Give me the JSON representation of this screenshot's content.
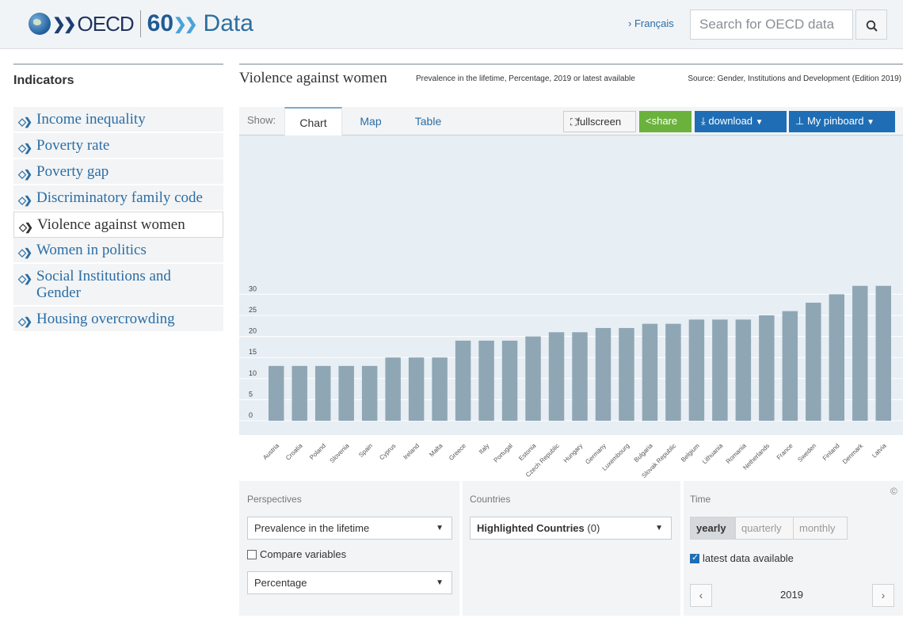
{
  "header": {
    "brand": "OECD",
    "anniversary": "60",
    "section": "Data",
    "language_link": "› Français",
    "search_placeholder": "Search for OECD data"
  },
  "sidebar": {
    "title": "Indicators",
    "items": [
      {
        "label": "Income inequality",
        "active": false
      },
      {
        "label": "Poverty rate",
        "active": false
      },
      {
        "label": "Poverty gap",
        "active": false
      },
      {
        "label": "Discriminatory family code",
        "active": false
      },
      {
        "label": "Violence against women",
        "active": true
      },
      {
        "label": "Women in politics",
        "active": false
      },
      {
        "label": "Social Institutions and Gender",
        "active": false
      },
      {
        "label": "Housing overcrowding",
        "active": false
      }
    ]
  },
  "main": {
    "title": "Violence against women",
    "subtitle": "Prevalence in the lifetime, Percentage, 2019 or latest available",
    "source": "Source: Gender, Institutions and Development (Edition 2019)"
  },
  "toolbar": {
    "show_label": "Show:",
    "tabs": [
      "Chart",
      "Map",
      "Table"
    ],
    "active_tab": "Chart",
    "fullscreen": "fullscreen",
    "share": "share",
    "download": "download",
    "pinboard": "My pinboard"
  },
  "chart_data": {
    "type": "bar",
    "categories": [
      "Austria",
      "Croatia",
      "Poland",
      "Slovenia",
      "Spain",
      "Cyprus",
      "Ireland",
      "Malta",
      "Greece",
      "Italy",
      "Portugal",
      "Estonia",
      "Czech Republic",
      "Hungary",
      "Germany",
      "Luxembourg",
      "Bulgaria",
      "Slovak Republic",
      "Belgium",
      "Lithuania",
      "Romania",
      "Netherlands",
      "France",
      "Sweden",
      "Finland",
      "Denmark",
      "Latvia"
    ],
    "values": [
      13,
      13,
      13,
      13,
      13,
      15,
      15,
      15,
      19,
      19,
      19,
      20,
      21,
      21,
      22,
      22,
      23,
      23,
      24,
      24,
      24,
      25,
      26,
      28,
      30,
      32,
      32
    ],
    "yticks": [
      0,
      5,
      10,
      15,
      20,
      25,
      30
    ],
    "ylim": [
      0,
      34
    ],
    "bar_color": "#8fa6b5",
    "background": "#e7eef4",
    "grid": true
  },
  "controls": {
    "perspectives_label": "Perspectives",
    "perspective_value": "Prevalence in the lifetime",
    "compare_label": "Compare variables",
    "compare_checked": false,
    "unit_value": "Percentage",
    "countries_label": "Countries",
    "countries_value": "Highlighted Countries",
    "countries_count": "(0)",
    "time_label": "Time",
    "frequencies": [
      "yearly",
      "quarterly",
      "monthly"
    ],
    "active_frequency": "yearly",
    "latest_label": "latest data available",
    "latest_checked": true,
    "year": "2019",
    "copyright": "©"
  }
}
